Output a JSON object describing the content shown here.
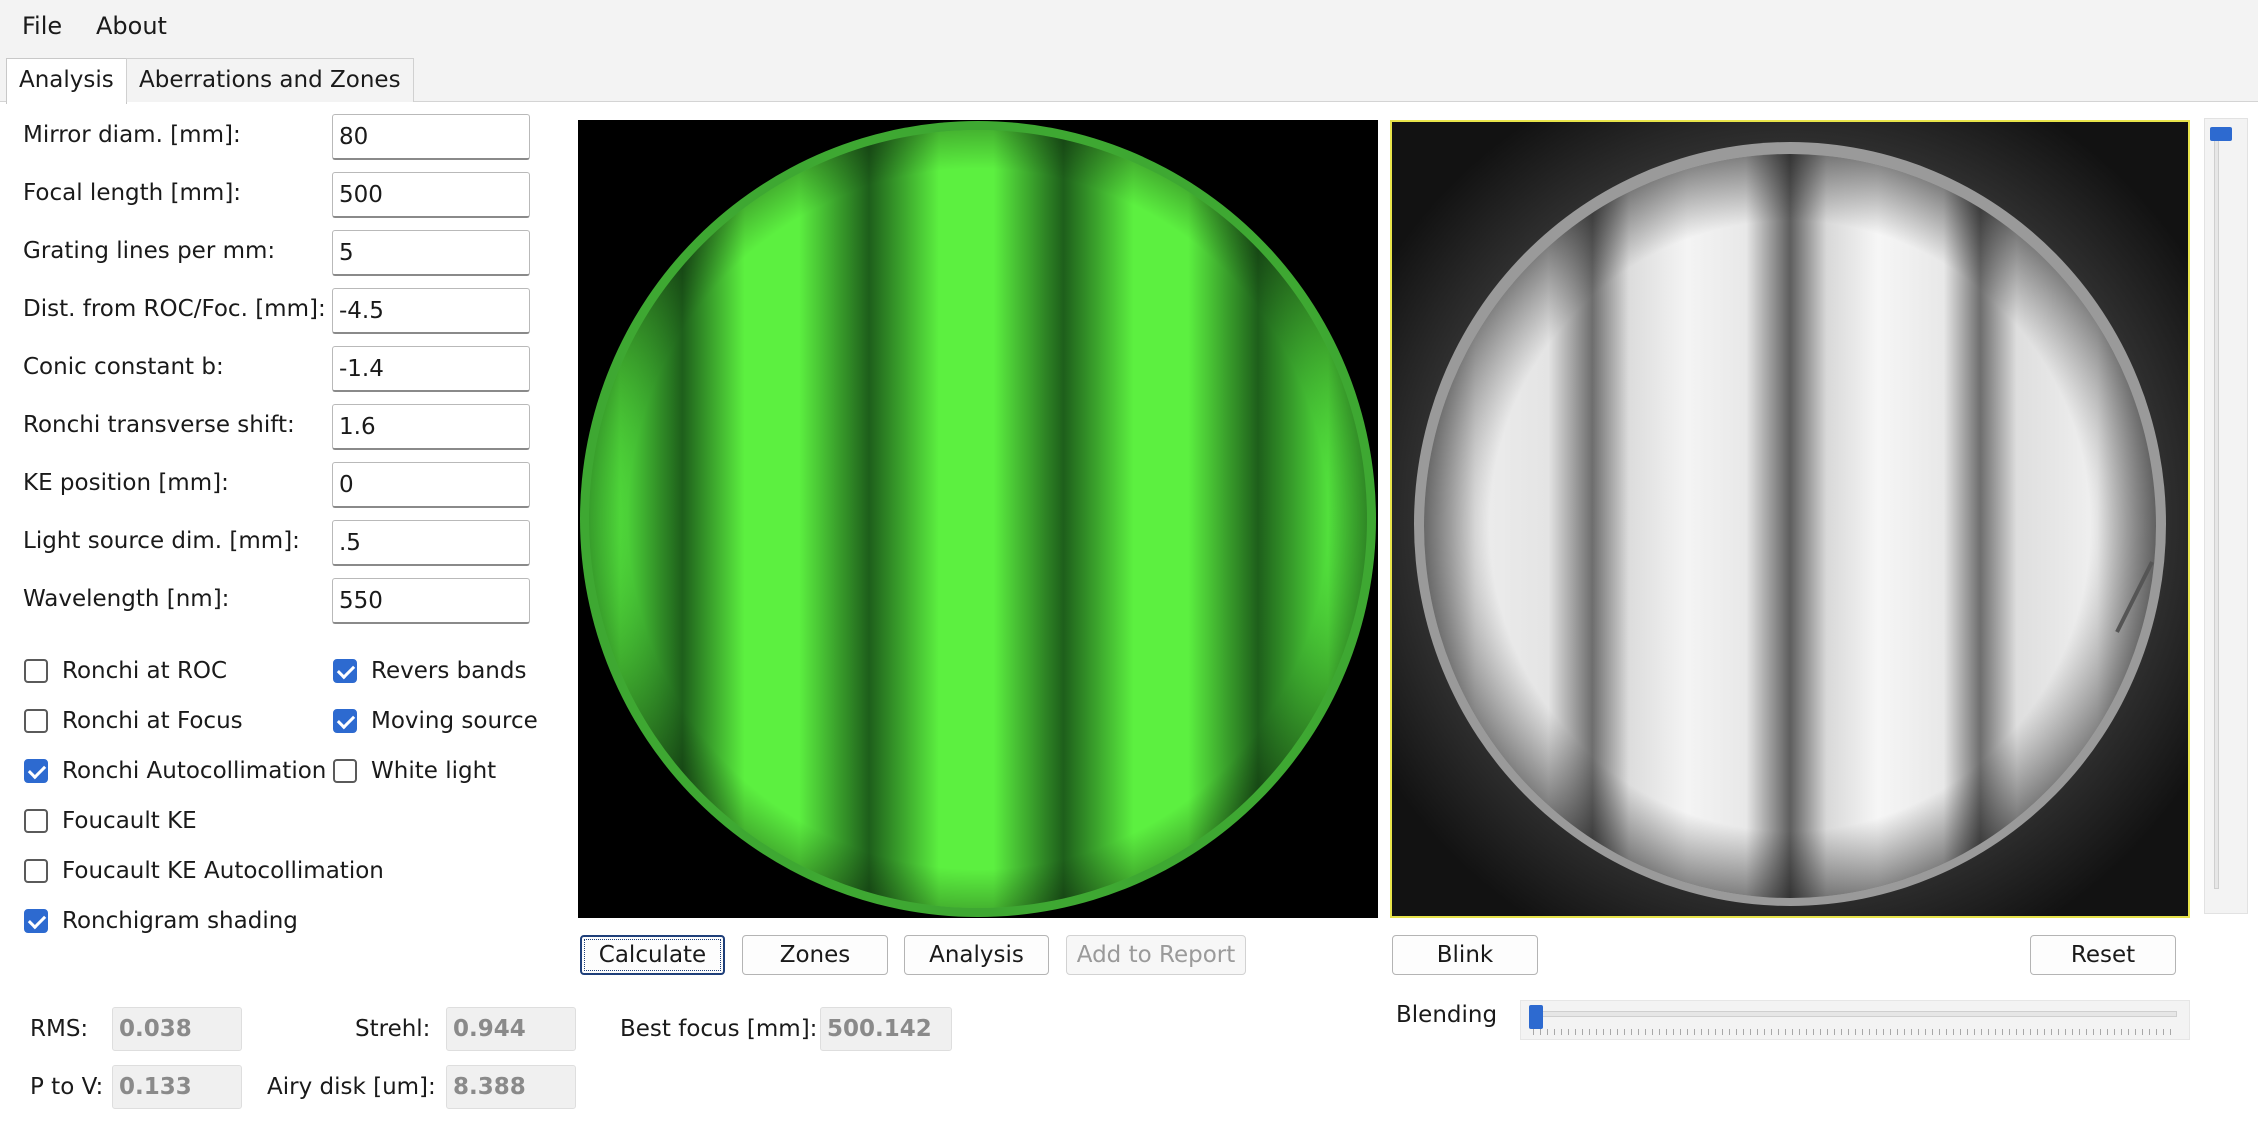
{
  "menu": [
    "File",
    "About"
  ],
  "tabs": [
    {
      "label": "Analysis",
      "active": true
    },
    {
      "label": "Aberrations and Zones",
      "active": false
    }
  ],
  "params": [
    {
      "label": "Mirror diam. [mm]:",
      "value": "80"
    },
    {
      "label": "Focal length [mm]:",
      "value": "500"
    },
    {
      "label": "Grating lines per mm:",
      "value": "5"
    },
    {
      "label": "Dist. from ROC/Foc. [mm]:",
      "value": "-4.5"
    },
    {
      "label": "Conic constant b:",
      "value": "-1.4"
    },
    {
      "label": "Ronchi transverse shift:",
      "value": "1.6"
    },
    {
      "label": "KE position [mm]:",
      "value": "0"
    },
    {
      "label": "Light source dim. [mm]:",
      "value": ".5"
    },
    {
      "label": "Wavelength [nm]:",
      "value": "550"
    }
  ],
  "options_left": [
    {
      "label": "Ronchi at ROC",
      "checked": false
    },
    {
      "label": "Ronchi at Focus",
      "checked": false
    },
    {
      "label": "Ronchi Autocollimation",
      "checked": true
    },
    {
      "label": "Foucault KE",
      "checked": false
    },
    {
      "label": "Foucault KE Autocollimation",
      "checked": false
    },
    {
      "label": "Ronchigram shading",
      "checked": true
    }
  ],
  "options_right": [
    {
      "label": "Revers bands",
      "checked": true
    },
    {
      "label": "Moving source",
      "checked": true
    },
    {
      "label": "White light",
      "checked": false
    }
  ],
  "buttons": {
    "calculate": "Calculate",
    "zones": "Zones",
    "analysis": "Analysis",
    "add_to_report": "Add to Report",
    "blink": "Blink",
    "reset": "Reset"
  },
  "results": {
    "rms_label": "RMS:",
    "rms": "0.038",
    "strehl_label": "Strehl:",
    "strehl": "0.944",
    "best_focus_label": "Best focus [mm]:",
    "best_focus": "500.142",
    "ptov_label": "P to V:",
    "ptov": "0.133",
    "airy_label": "Airy disk [um]:",
    "airy": "8.388"
  },
  "blending": {
    "label": "Blending",
    "value": 0.0
  },
  "vertical_slider": {
    "value": 1.0
  },
  "colors": {
    "band_bright": "#5cf040",
    "band_dark": "#1d5a1a",
    "checkbox_accent": "#2d6ad0",
    "photo_frame": "#e8e44a"
  }
}
